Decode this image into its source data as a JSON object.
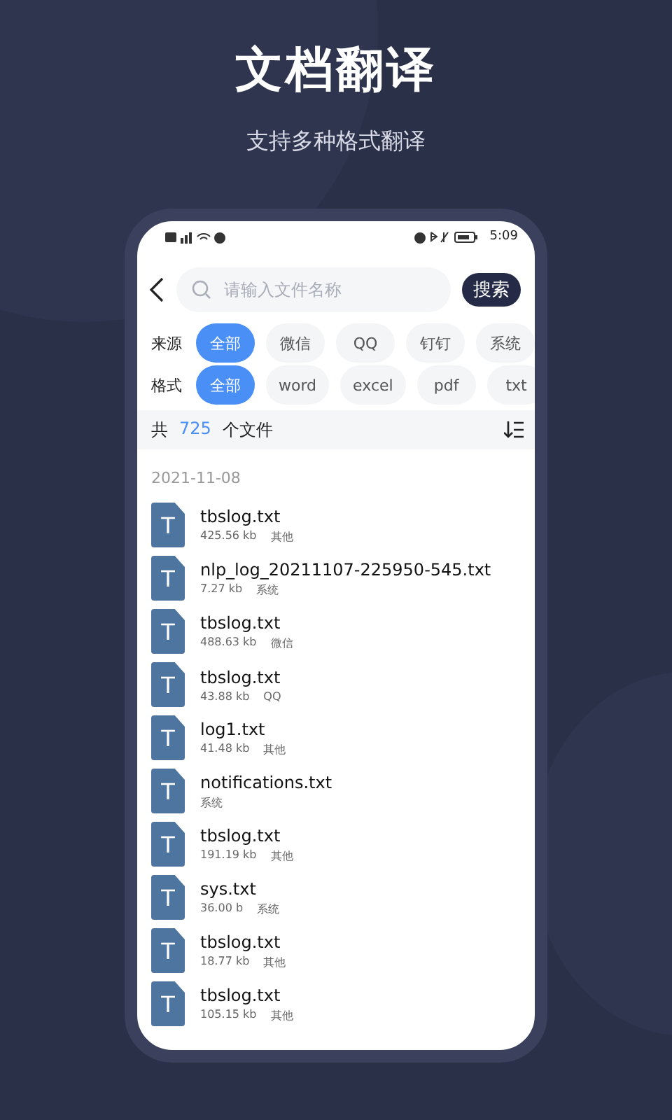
{
  "headline": {
    "title": "文档翻译",
    "subtitle": "支持多种格式翻译"
  },
  "status_bar": {
    "time": "5:09"
  },
  "search": {
    "placeholder": "请输入文件名称",
    "button": "搜索"
  },
  "filters": [
    {
      "label": "来源",
      "options": [
        {
          "label": "全部",
          "selected": true
        },
        {
          "label": "微信",
          "selected": false
        },
        {
          "label": "QQ",
          "selected": false
        },
        {
          "label": "钉钉",
          "selected": false
        },
        {
          "label": "系统",
          "selected": false
        }
      ]
    },
    {
      "label": "格式",
      "options": [
        {
          "label": "全部",
          "selected": true
        },
        {
          "label": "word",
          "selected": false
        },
        {
          "label": "excel",
          "selected": false
        },
        {
          "label": "pdf",
          "selected": false
        },
        {
          "label": "txt",
          "selected": false
        }
      ]
    }
  ],
  "summary": {
    "prefix": "共",
    "count": "725",
    "suffix": "个文件"
  },
  "date": "2021-11-08",
  "files": [
    {
      "icon_letter": "T",
      "name": "tbslog.txt",
      "size": "425.56 kb",
      "source": "其他"
    },
    {
      "icon_letter": "T",
      "name": "nlp_log_20211107-225950-545.txt",
      "size": "7.27 kb",
      "source": "系统"
    },
    {
      "icon_letter": "T",
      "name": "tbslog.txt",
      "size": "488.63 kb",
      "source": "微信"
    },
    {
      "icon_letter": "T",
      "name": "tbslog.txt",
      "size": "43.88 kb",
      "source": "QQ"
    },
    {
      "icon_letter": "T",
      "name": "log1.txt",
      "size": "41.48 kb",
      "source": "其他"
    },
    {
      "icon_letter": "T",
      "name": "notifications.txt",
      "source": "系统"
    },
    {
      "icon_letter": "T",
      "name": "tbslog.txt",
      "size": "191.19 kb",
      "source": "其他"
    },
    {
      "icon_letter": "T",
      "name": "sys.txt",
      "size": "36.00 b",
      "source": "系统"
    },
    {
      "icon_letter": "T",
      "name": "tbslog.txt",
      "size": "18.77 kb",
      "source": "其他"
    },
    {
      "icon_letter": "T",
      "name": "tbslog.txt",
      "size": "105.15 kb",
      "source": "其他"
    }
  ]
}
